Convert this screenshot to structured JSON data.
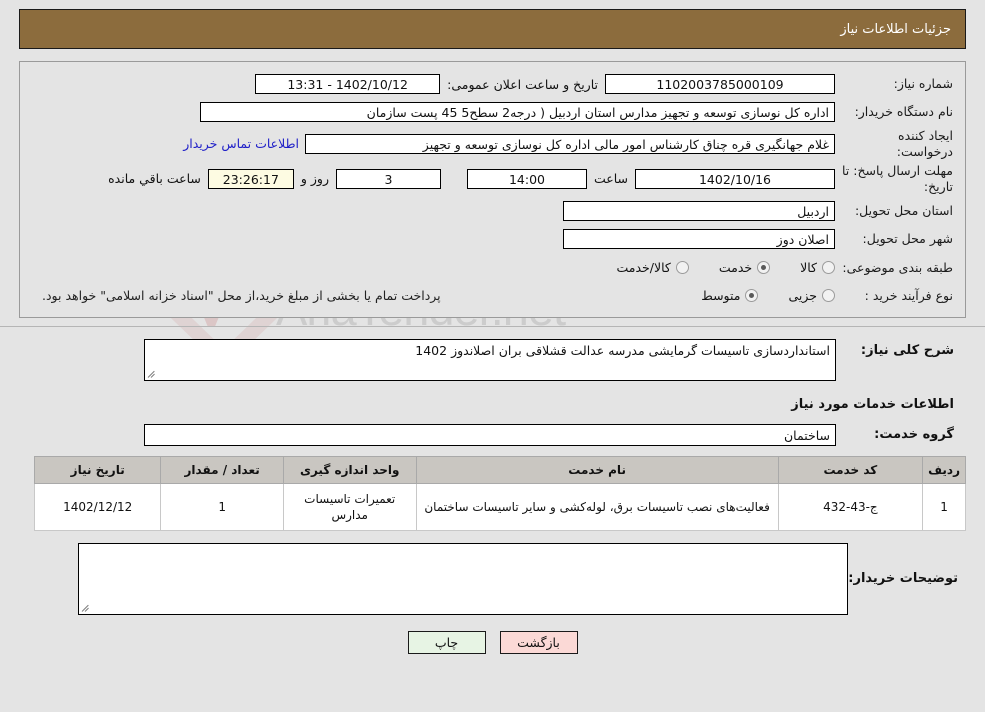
{
  "header": {
    "title": "جزئیات اطلاعات نیاز"
  },
  "form": {
    "need_number_label": "شماره نیاز:",
    "need_number_value": "1102003785000109",
    "announce_label": "تاریخ و ساعت اعلان عمومی:",
    "announce_value": "1402/10/12 - 13:31",
    "buyer_org_label": "نام دستگاه خریدار:",
    "buyer_org_value": "اداره کل نوسازی  توسعه و تجهیز مدارس استان اردبیل ( درجه2  سطح5  45 پست سازمان",
    "creator_label": "ایجاد کننده درخواست:",
    "creator_value": "غلام جهانگیری قره چناق کارشناس امور مالی اداره کل نوسازی  توسعه و تجهیز",
    "contact_link": "اطلاعات تماس خریدار",
    "deadline_label": "مهلت ارسال پاسخ: تا تاریخ:",
    "deadline_date": "1402/10/16",
    "hour_label": "ساعت",
    "deadline_time": "14:00",
    "days_value": "3",
    "days_label": "روز و",
    "remaining_time": "23:26:17",
    "remaining_label": "ساعت باقي مانده",
    "province_label": "استان محل تحویل:",
    "province_value": "اردبیل",
    "city_label": "شهر محل تحویل:",
    "city_value": "اصلان دوز",
    "category_label": "طبقه بندی موضوعی:",
    "category_options": [
      {
        "label": "کالا",
        "selected": false
      },
      {
        "label": "خدمت",
        "selected": true
      },
      {
        "label": "کالا/خدمت",
        "selected": false
      }
    ],
    "process_label": "نوع فرآیند خرید :",
    "process_options": [
      {
        "label": "جزیی",
        "selected": false
      },
      {
        "label": "متوسط",
        "selected": true
      }
    ],
    "payment_note": "پرداخت تمام یا بخشی از مبلغ خرید،از محل \"اسناد خزانه اسلامی\" خواهد بود."
  },
  "description": {
    "label": "شرح کلی نیاز:",
    "value": "استانداردسازی تاسیسات گرمایشی مدرسه عدالت قشلاقی بران اصلاندوز 1402"
  },
  "services_section": {
    "heading": "اطلاعات خدمات مورد نیاز",
    "group_label": "گروه خدمت:",
    "group_value": "ساختمان"
  },
  "table": {
    "headers": [
      "ردیف",
      "کد خدمت",
      "نام خدمت",
      "واحد اندازه گیری",
      "تعداد / مقدار",
      "تاریخ نیاز"
    ],
    "rows": [
      {
        "radif": "1",
        "code": "ج-43-432",
        "name": "فعالیت‌های نصب تاسیسات برق، لوله‌کشی و سایر تاسیسات ساختمان",
        "unit": "تعمیرات تاسیسات مدارس",
        "qty": "1",
        "date": "1402/12/12"
      }
    ]
  },
  "comments": {
    "label": "توضیحات خریدار:",
    "value": ""
  },
  "buttons": {
    "print": "چاپ",
    "back": "بازگشت"
  },
  "colors": {
    "header_bar": "#8c6c3d",
    "link": "#2020c8",
    "table_header": "#c9c6c1",
    "print_button": "#e7f4e4",
    "back_button": "#fbd9d6",
    "highlight_field": "#fdfbe2"
  },
  "watermark": {
    "text": "AriaTender.net"
  }
}
